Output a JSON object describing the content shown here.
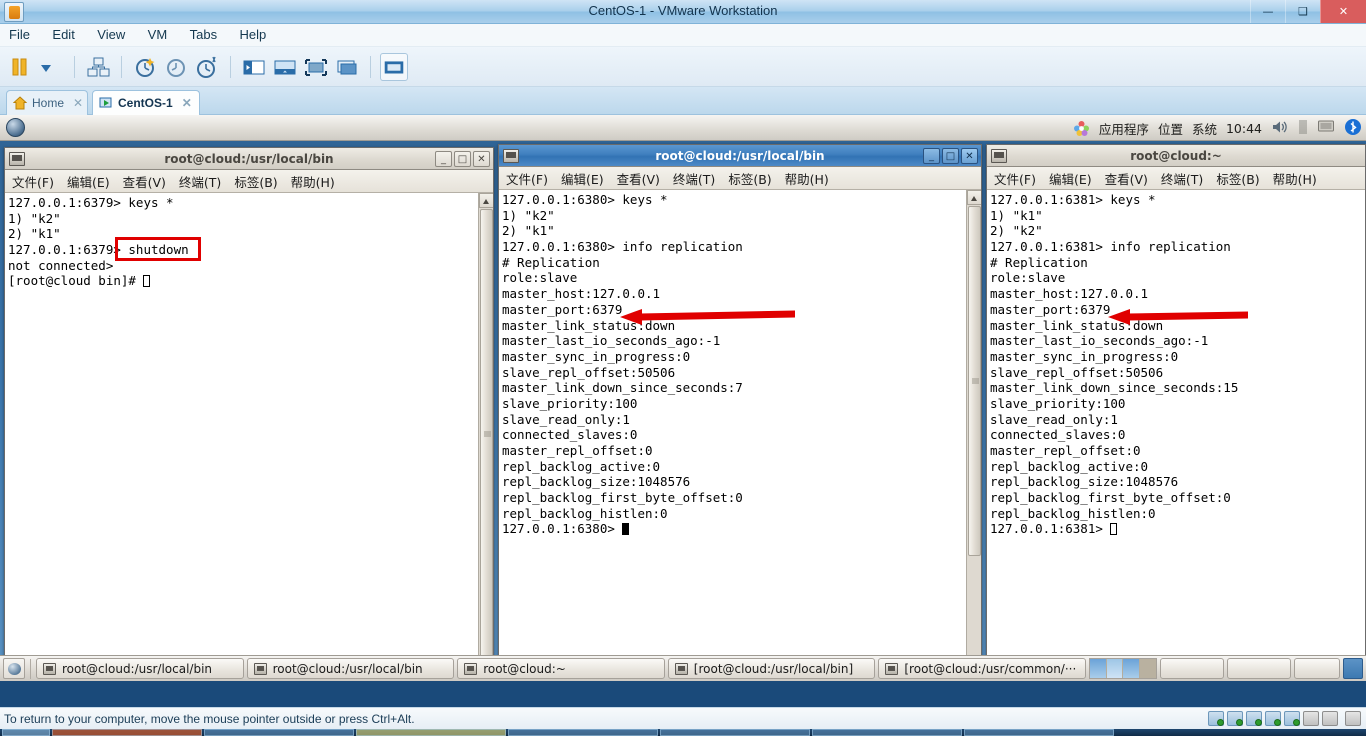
{
  "vmware": {
    "window_title": "CentOS-1 - VMware Workstation",
    "app_icon": "vmware-icon",
    "window_controls": {
      "minimize": "–",
      "maximize": "❐",
      "close": "✕"
    },
    "menus": [
      "File",
      "Edit",
      "View",
      "VM",
      "Tabs",
      "Help"
    ],
    "toolbar_icons": [
      "power-pause-icon",
      "dropdown-arrow-icon",
      "snapshot-manager-icon",
      "take-snapshot-icon",
      "revert-snapshot-icon",
      "manage-snapshots-icon",
      "show-sidebar-icon",
      "show-console-icon",
      "fullscreen-icon",
      "unity-mode-icon",
      "show-thumbnail-bar-icon"
    ],
    "tabs": [
      {
        "label": "Home",
        "icon": "home-icon",
        "close": "✕",
        "active": false
      },
      {
        "label": "CentOS-1",
        "icon": "vm-running-icon",
        "close": "✕",
        "active": true
      }
    ],
    "status_message": "To return to your computer, move the mouse pointer outside or press Ctrl+Alt.",
    "status_icons": [
      "hard-disk-icon",
      "cd-dvd-icon",
      "network-adapter-icon",
      "printer-icon",
      "sound-card-icon",
      "usb-icon",
      "display-icon",
      "settings-icon"
    ]
  },
  "gnome_panel_top": {
    "menu_icon": "gnome-foot-icon",
    "items": [
      "应用程序",
      "位置",
      "系统"
    ],
    "clock": "10:44",
    "tray": [
      "volume-icon",
      "sound-meter-icon",
      "display-icon",
      "bluetooth-icon"
    ]
  },
  "terminals": [
    {
      "title": "root@cloud:/usr/local/bin",
      "active": false,
      "window_icon": "terminal-icon",
      "controls": {
        "minimize": "_",
        "maximize": "□",
        "close": "✕"
      },
      "menus": [
        "文件(F)",
        "编辑(E)",
        "查看(V)",
        "终端(T)",
        "标签(B)",
        "帮助(H)"
      ],
      "lines": [
        "127.0.0.1:6379> keys *",
        "1) \"k2\"",
        "2) \"k1\"",
        "127.0.0.1:6379> shutdown",
        "not connected>",
        "[root@cloud bin]# "
      ],
      "cursor_line": 5,
      "cursor_style": "hollow",
      "annotation": {
        "type": "box",
        "label": "shutdown-highlight-box",
        "color": "#e00000"
      }
    },
    {
      "title": "root@cloud:/usr/local/bin",
      "active": true,
      "window_icon": "terminal-icon",
      "controls": {
        "minimize": "_",
        "maximize": "□",
        "close": "✕"
      },
      "menus": [
        "文件(F)",
        "编辑(E)",
        "查看(V)",
        "终端(T)",
        "标签(B)",
        "帮助(H)"
      ],
      "lines": [
        "127.0.0.1:6380> keys *",
        "1) \"k2\"",
        "2) \"k1\"",
        "127.0.0.1:6380> info replication",
        "# Replication",
        "role:slave",
        "master_host:127.0.0.1",
        "master_port:6379",
        "master_link_status:down",
        "master_last_io_seconds_ago:-1",
        "master_sync_in_progress:0",
        "slave_repl_offset:50506",
        "master_link_down_since_seconds:7",
        "slave_priority:100",
        "slave_read_only:1",
        "connected_slaves:0",
        "master_repl_offset:0",
        "repl_backlog_active:0",
        "repl_backlog_size:1048576",
        "repl_backlog_first_byte_offset:0",
        "repl_backlog_histlen:0",
        "127.0.0.1:6380> "
      ],
      "cursor_line": 21,
      "cursor_style": "solid",
      "annotation": {
        "type": "arrow",
        "label": "master-port-arrow",
        "color": "#e00000",
        "points_to": "master_port:6379"
      }
    },
    {
      "title": "root@cloud:~",
      "active": false,
      "window_icon": "terminal-icon",
      "controls": {
        "minimize": "_",
        "maximize": "□",
        "close": "✕"
      },
      "menus": [
        "文件(F)",
        "编辑(E)",
        "查看(V)",
        "终端(T)",
        "标签(B)",
        "帮助(H)"
      ],
      "lines": [
        "127.0.0.1:6381> keys *",
        "1) \"k1\"",
        "2) \"k2\"",
        "127.0.0.1:6381> info replication",
        "# Replication",
        "role:slave",
        "master_host:127.0.0.1",
        "master_port:6379",
        "master_link_status:down",
        "master_last_io_seconds_ago:-1",
        "master_sync_in_progress:0",
        "slave_repl_offset:50506",
        "master_link_down_since_seconds:15",
        "slave_priority:100",
        "slave_read_only:1",
        "connected_slaves:0",
        "master_repl_offset:0",
        "repl_backlog_active:0",
        "repl_backlog_size:1048576",
        "repl_backlog_first_byte_offset:0",
        "repl_backlog_histlen:0",
        "127.0.0.1:6381> "
      ],
      "cursor_line": 21,
      "cursor_style": "hollow",
      "annotation": {
        "type": "arrow",
        "label": "master-port-arrow",
        "color": "#e00000",
        "points_to": "master_port:6379"
      }
    }
  ],
  "gnome_panel_bottom": {
    "show_desktop_icon": "show-desktop-icon",
    "tasks": [
      {
        "label": "root@cloud:/usr/local/bin",
        "icon": "terminal-icon"
      },
      {
        "label": "root@cloud:/usr/local/bin",
        "icon": "terminal-icon"
      },
      {
        "label": "root@cloud:~",
        "icon": "terminal-icon"
      },
      {
        "label": "[root@cloud:/usr/local/bin]",
        "icon": "terminal-icon"
      },
      {
        "label": "[root@cloud:/usr/common/···",
        "icon": "terminal-icon"
      }
    ],
    "workspace_count": 4,
    "active_workspace": 1,
    "trash_icon": "trash-icon"
  },
  "colors": {
    "annotation_red": "#e00000",
    "active_titlebar_blue": "#3f7fbe",
    "vmware_titlebar": "#a9cfeb",
    "terminal_bg": "#ffffff",
    "terminal_fg": "#000000"
  }
}
